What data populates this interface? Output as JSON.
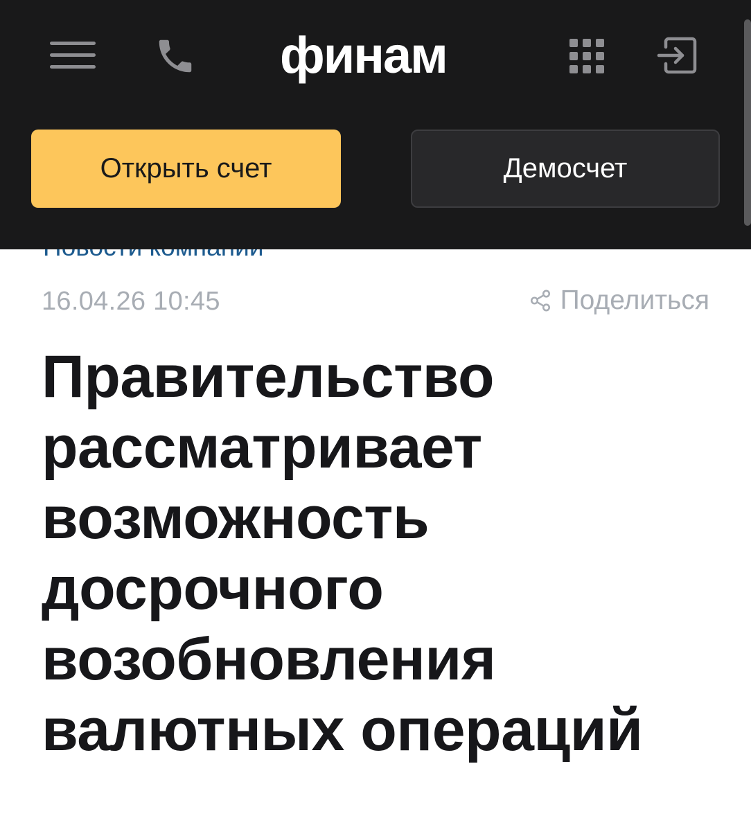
{
  "header": {
    "logo": "финам",
    "open_account_label": "Открыть счет",
    "demo_account_label": "Демосчет"
  },
  "article": {
    "category": "Новости компании",
    "date": "16.04.26 10:45",
    "share_label": "Поделиться",
    "title_lines": [
      "Правительство",
      "рассматривает",
      "возможность",
      "досрочного",
      "возобновления",
      "валютных операций"
    ]
  },
  "colors": {
    "header_bg": "#19191a",
    "accent_yellow": "#fdc65b",
    "link_blue": "#1d5b8f",
    "meta_gray": "#a8adb4"
  },
  "icons": [
    "menu-icon",
    "phone-icon",
    "apps-grid-icon",
    "login-icon",
    "share-icon"
  ]
}
